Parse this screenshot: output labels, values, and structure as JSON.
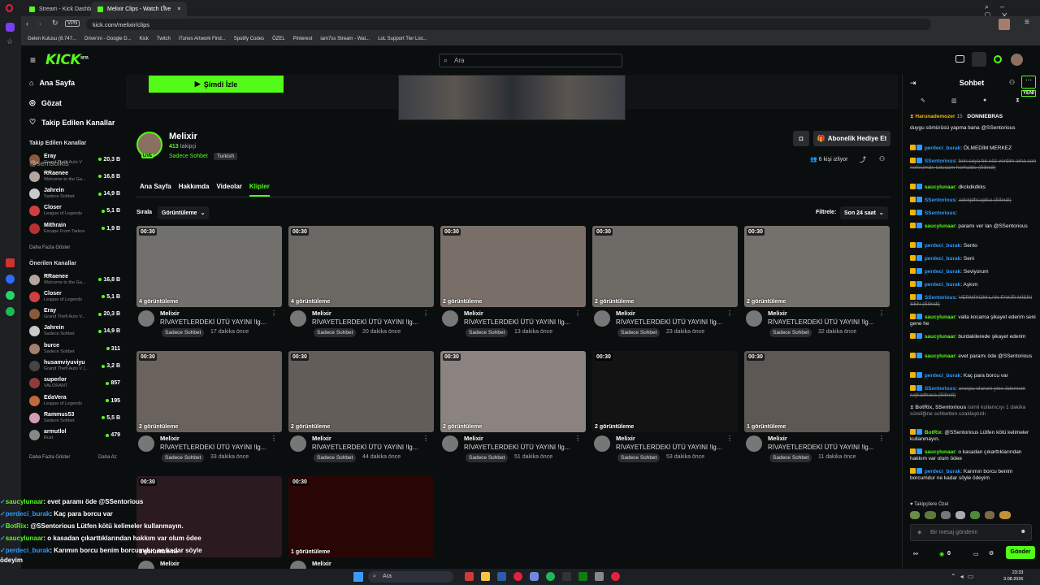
{
  "browser": {
    "tabs": [
      "Stream - Kick Dashboard",
      "Melixir Clips - Watch Live"
    ],
    "url": "kick.com/melixir/clips",
    "vpn": "VPN",
    "bookmarks": [
      "Gelen Kutusu (8.747...",
      "Drive'ım - Google D...",
      "Kick",
      "Twitch",
      "iTunes Artwork Find...",
      "Spotify Codes",
      "ÖZEL",
      "Pinterest",
      "iam7ss Stream - Wat...",
      "LoL Support Tier List..."
    ]
  },
  "header": {
    "logo": "KICK",
    "beta": "BETA",
    "search_placeholder": "Ara"
  },
  "sidebar": {
    "nav": [
      "Ana Sayfa",
      "Gözat",
      "Takip Edilen Kanallar"
    ],
    "followed_title": "Takip Edilen Kanallar",
    "followed": [
      {
        "name": "Eray",
        "category": "Grand Theft Auto V",
        "viewers": "20,3 B",
        "color": "#8a5a3a"
      },
      {
        "name": "RRaenee",
        "category": "Welcome to the Ga...",
        "viewers": "16,8 B",
        "color": "#b5a4a0"
      },
      {
        "name": "Jahrein",
        "category": "Sadece Sohbet",
        "viewers": "14,9 B",
        "color": "#c9c9c9"
      },
      {
        "name": "Closer",
        "category": "League of Legends",
        "viewers": "5,1 B",
        "color": "#d04040"
      },
      {
        "name": "Mithrain",
        "category": "Escape From Tarkov",
        "viewers": "1,9 B",
        "color": "#b83030"
      }
    ],
    "show_more": "Daha Fazla Göster",
    "watermark": "@semsolkis",
    "recommended_title": "Önerilen Kanallar",
    "recommended": [
      {
        "name": "RRaenee",
        "category": "Welcome to the Ga...",
        "viewers": "16,8 B",
        "color": "#b5a4a0"
      },
      {
        "name": "Closer",
        "category": "League of Legends",
        "viewers": "5,1 B",
        "color": "#d04040"
      },
      {
        "name": "Eray",
        "category": "Grand Theft Auto V...",
        "viewers": "20,3 B",
        "color": "#8a5a3a"
      },
      {
        "name": "Jahrein",
        "category": "Sadece Sohbet",
        "viewers": "14,9 B",
        "color": "#c9c9c9"
      },
      {
        "name": "burce",
        "category": "Sadece Sohbet",
        "viewers": "311",
        "color": "#a27f6f"
      },
      {
        "name": "husamviyuviyu",
        "category": "Grand Theft Auto V (...",
        "viewers": "3,2 B",
        "color": "#444"
      },
      {
        "name": "superlor",
        "category": "VALORANT",
        "viewers": "857",
        "color": "#8f3b3b"
      },
      {
        "name": "EdaVera",
        "category": "League of Legends",
        "viewers": "195",
        "color": "#c06a3a"
      },
      {
        "name": "Rammus53",
        "category": "Sadece Sohbet",
        "viewers": "5,5 B",
        "color": "#d0a0b0"
      },
      {
        "name": "armutlol",
        "category": "Rust",
        "viewers": "479",
        "color": "#888"
      }
    ],
    "show_more2": "Daha Fazla Göster",
    "show_less": "Daha Az"
  },
  "channel": {
    "watch_now": "Şimdi İzle",
    "name": "Melixir",
    "followers_count": "413",
    "followers_label": "takipçi",
    "category": "Sadece Sohbet",
    "language": "Turkish",
    "live_badge": "LIVE",
    "gift_sub": "Abonelik Hediye Et",
    "watching": "6 kişi izliyor",
    "tabs": [
      "Ana Sayfa",
      "Hakkımda",
      "Videolar",
      "Klipler"
    ],
    "sort_label": "Sırala",
    "sort_value": "Görüntüleme",
    "filter_label": "Filtrele:",
    "filter_value": "Son 24 saat"
  },
  "clips": [
    {
      "duration": "00:30",
      "views": "4 görüntüleme",
      "author": "Melixir",
      "title": "RİVAYETLERDEKİ ÜTÜ YAYINI !lg...",
      "category": "Sadece Sohbet",
      "ago": "17 dakika önce"
    },
    {
      "duration": "00:30",
      "views": "4 görüntüleme",
      "author": "Melixir",
      "title": "RİVAYETLERDEKİ ÜTÜ YAYINI !lg...",
      "category": "Sadece Sohbet",
      "ago": "20 dakika önce"
    },
    {
      "duration": "00:30",
      "views": "2 görüntüleme",
      "author": "Melixir",
      "title": "RİVAYETLERDEKİ ÜTÜ YAYINI !lg...",
      "category": "Sadece Sohbet",
      "ago": "13 dakika önce"
    },
    {
      "duration": "00:30",
      "views": "2 görüntüleme",
      "author": "Melixir",
      "title": "RİVAYETLERDEKİ ÜTÜ YAYINI !lg...",
      "category": "Sadece Sohbet",
      "ago": "23 dakika önce"
    },
    {
      "duration": "00:30",
      "views": "2 görüntüleme",
      "author": "Melixir",
      "title": "RİVAYETLERDEKİ ÜTÜ YAYINI !lg...",
      "category": "Sadece Sohbet",
      "ago": "32 dakika önce"
    },
    {
      "duration": "00:30",
      "views": "2 görüntüleme",
      "author": "Melixir",
      "title": "RİVAYETLERDEKİ ÜTÜ YAYINI !lg...",
      "category": "Sadece Sohbet",
      "ago": "33 dakika önce"
    },
    {
      "duration": "00:30",
      "views": "2 görüntüleme",
      "author": "Melixir",
      "title": "RİVAYETLERDEKİ ÜTÜ YAYINI !lg...",
      "category": "Sadece Sohbet",
      "ago": "44 dakika önce"
    },
    {
      "duration": "00:30",
      "views": "2 görüntüleme",
      "author": "Melixir",
      "title": "RİVAYETLERDEKİ ÜTÜ YAYINI !lg...",
      "category": "Sadece Sohbet",
      "ago": "51 dakika önce"
    },
    {
      "duration": "00:30",
      "views": "2 görüntüleme",
      "author": "Melixir",
      "title": "RİVAYETLERDEKİ ÜTÜ YAYINI !lg...",
      "category": "Sadece Sohbet",
      "ago": "53 dakika önce"
    },
    {
      "duration": "00:30",
      "views": "1 görüntüleme",
      "author": "Melixir",
      "title": "RİVAYETLERDEKİ ÜTÜ YAYINI !lg...",
      "category": "Sadece Sohbet",
      "ago": "11 dakika önce"
    },
    {
      "duration": "00:30",
      "views": "1 görüntüleme",
      "author": "Melixir",
      "title": "",
      "category": "",
      "ago": ""
    },
    {
      "duration": "00:30",
      "views": "1 görüntüleme",
      "author": "Melixir",
      "title": "",
      "category": "",
      "ago": ""
    }
  ],
  "chat": {
    "title": "Sohbet",
    "new_label": "YENİ",
    "gifters": [
      "Harunademozer",
      "15",
      "DONNIEBRAS"
    ],
    "messages": [
      {
        "user": "",
        "text": "duygu sömürüsü yapma bana @SSentorious",
        "color": "",
        "deleted": false
      },
      {
        "user": "perdeci_burak",
        "text": "ÖLMEDİM MERKEZ",
        "color": "#2e9bff",
        "deleted": false
      },
      {
        "user": "SSentorious",
        "text": "ben suya bir söz verdim ama son nefesimde tutucam herhalde (Silindi)",
        "color": "#2e9bff",
        "deleted": true
      },
      {
        "user": "saucylunaar",
        "text": "dkckdkdkks",
        "color": "#53fc18",
        "deleted": false
      },
      {
        "user": "SSentorious",
        "text": "adekjdhsajdsa (Silindi)",
        "color": "#2e9bff",
        "deleted": true
      },
      {
        "user": "SSentorious",
        "text": "",
        "color": "#2e9bff",
        "deleted": false
      },
      {
        "user": "saucylunaar",
        "text": "paramı ver lan @SSentorious",
        "color": "#53fc18",
        "deleted": false
      },
      {
        "user": "perdeci_burak",
        "text": "Sento",
        "color": "#2e9bff",
        "deleted": false
      },
      {
        "user": "perdeci_burak",
        "text": "Seni",
        "color": "#2e9bff",
        "deleted": false
      },
      {
        "user": "perdeci_burak",
        "text": "Seviyorum",
        "color": "#2e9bff",
        "deleted": false
      },
      {
        "user": "perdeci_burak",
        "text": "Aşkım",
        "color": "#2e9bff",
        "deleted": false
      },
      {
        "user": "SSentorious",
        "text": "VERMİYOM LAN FAKİR MİSİN SEN (Silindi)",
        "color": "#2e9bff",
        "deleted": true
      },
      {
        "user": "saucylunaar",
        "text": "valla kocama şikayet ederim seni gene he",
        "color": "#53fc18",
        "deleted": false
      },
      {
        "user": "saucylunaar",
        "text": "burdakilerede şikayet ederim",
        "color": "#53fc18",
        "deleted": false
      },
      {
        "user": "saucylunaar",
        "text": "evet paramı öde @SSentorious",
        "color": "#53fc18",
        "deleted": false
      },
      {
        "user": "perdeci_burak",
        "text": "Kaç para borcu var",
        "color": "#2e9bff",
        "deleted": false
      },
      {
        "user": "SSentorious",
        "text": "orospu olurum yine ödemem sajkadhasa (Silindi)",
        "color": "#2e9bff",
        "deleted": true
      },
      {
        "user": "BotRix, SSentorious",
        "text": "isimli kullanıcıyı 1 dakika süreliğine sohbetten uzaklaştırdı",
        "color": "#bbb",
        "deleted": false
      },
      {
        "user": "BotRix",
        "text": "@SSentorious Lütfen kötü kelimeler kullanmayın.",
        "color": "#53fc18",
        "deleted": false
      },
      {
        "user": "saucylunaar",
        "text": "o kasadan çıkarttıklarından hakkım var olum ödee",
        "color": "#53fc18",
        "deleted": false
      },
      {
        "user": "perdeci_burak",
        "text": "Karımın borcu benim borcumdur ne kadar söyle ödeyim",
        "color": "#2e9bff",
        "deleted": false
      }
    ],
    "emote_section": "Takipçilere Özel",
    "input_placeholder": "Bir mesaj gönderin",
    "points": "0",
    "send": "Gönder"
  },
  "overlay": [
    {
      "user": "saucylunaar",
      "text": "evet paramı öde @SSentorious",
      "color": "#53fc18"
    },
    {
      "user": "perdeci_burak",
      "text": "Kaç para borcu var",
      "color": "#2e9bff"
    },
    {
      "user": "BotRix",
      "text": "@SSentorious Lütfen kötü kelimeler kullanmayın.",
      "color": "#53fc18"
    },
    {
      "user": "saucylunaar",
      "text": "o kasadan çıkarttıklarından hakkım var olum ödee",
      "color": "#53fc18"
    },
    {
      "user": "perdeci_burak",
      "text": "Karımın borcu benim borcumdur ne kadar söyle ödeyim",
      "color": "#2e9bff"
    }
  ],
  "taskbar": {
    "search": "Ara",
    "time": "23:33",
    "date": "3.08.2026"
  }
}
